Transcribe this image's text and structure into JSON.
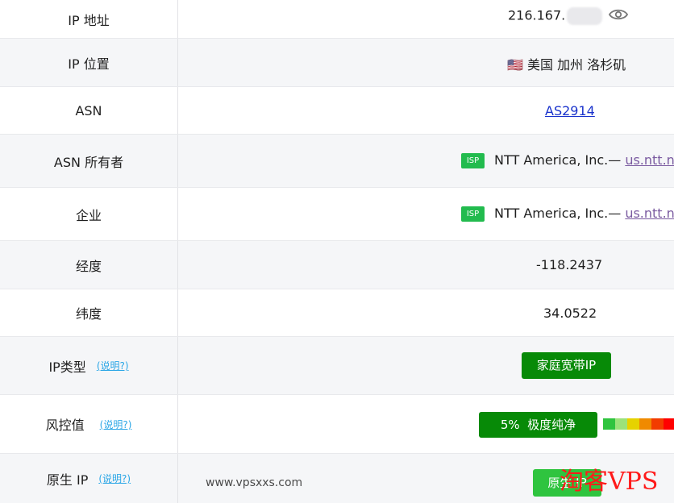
{
  "rows": [
    {
      "label": "IP 地址",
      "value": "216.167."
    },
    {
      "label": "IP 位置",
      "flag": "🇺🇸",
      "value": "美国 加州 洛杉矶"
    },
    {
      "label": "ASN",
      "value": "AS2914"
    },
    {
      "label": "ASN 所有者",
      "badge": "ISP",
      "value": "NTT America, Inc.—",
      "link": "us.ntt.ne"
    },
    {
      "label": "企业",
      "badge": "ISP",
      "value": "NTT America, Inc.—",
      "link": "us.ntt.ne"
    },
    {
      "label": "经度",
      "value": "-118.2437"
    },
    {
      "label": "纬度",
      "value": "34.0522"
    },
    {
      "label": "IP类型",
      "help": "(说明?)",
      "value": "家庭宽带IP"
    },
    {
      "label": "风控值",
      "help": "(说明?)",
      "value": "5%  极度纯净"
    },
    {
      "label": "原生 IP",
      "help": "(说明?)",
      "value": "原生 IP"
    }
  ],
  "risk_gauge": {
    "colors": [
      "#2fc43f",
      "#9be27a",
      "#e6d200",
      "#f08a00",
      "#f23c00",
      "#ff0000"
    ]
  },
  "site_text": "www.vpsxxs.com",
  "watermark": "淘客VPS",
  "colors": {
    "accent_green": "#078a07",
    "light_green": "#2fc43f",
    "link_blue": "#1a33cc"
  }
}
